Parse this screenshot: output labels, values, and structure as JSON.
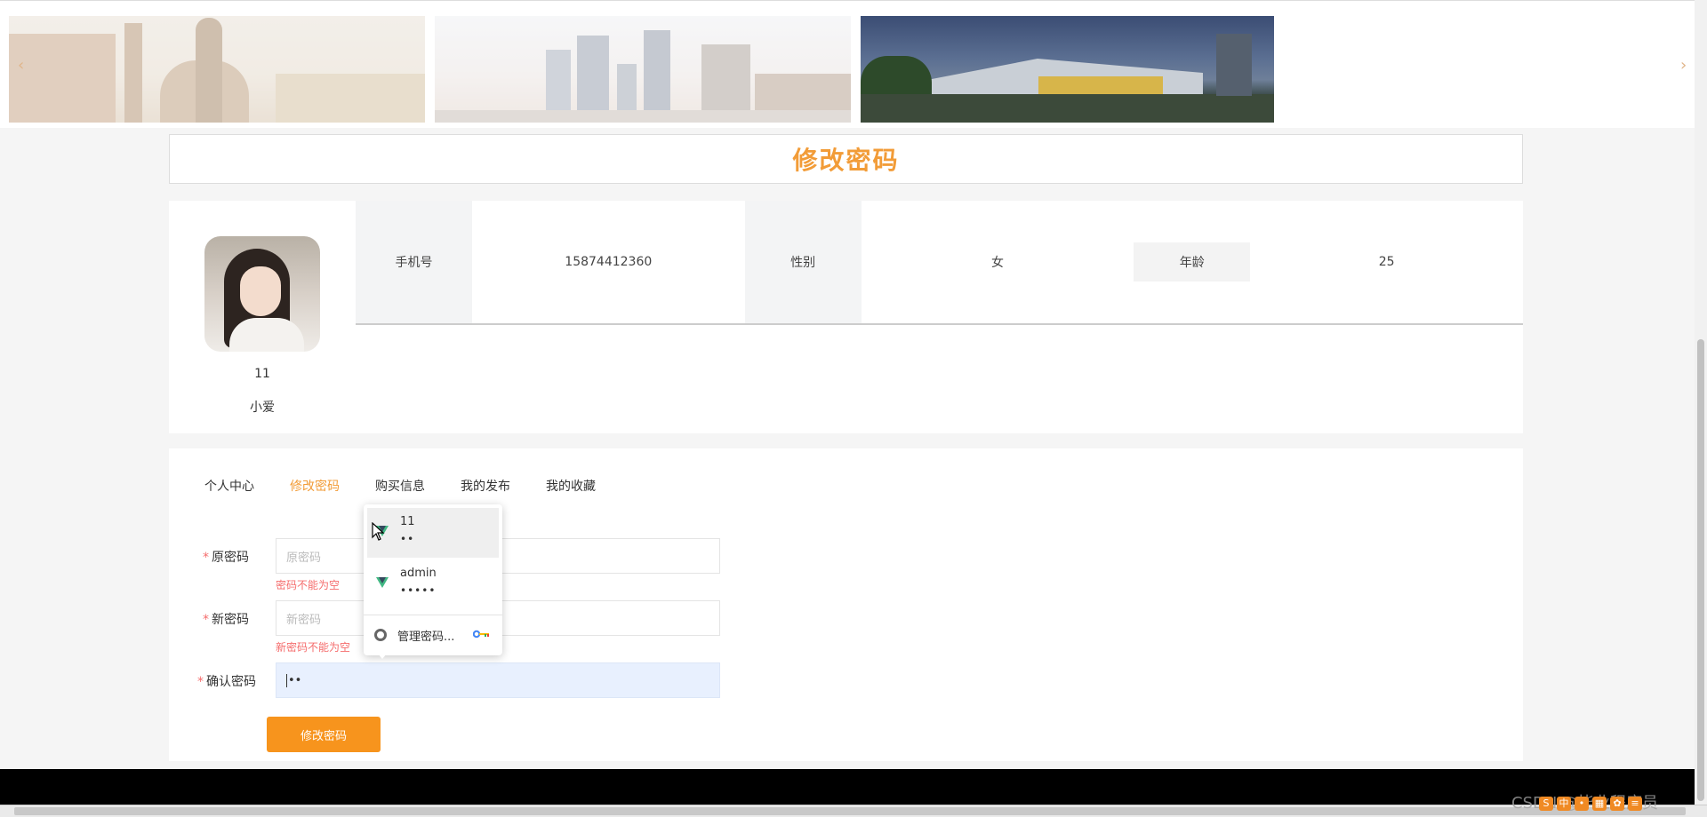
{
  "page_title": "修改密码",
  "profile": {
    "username": "11",
    "nickname": "小爱",
    "fields": [
      {
        "label": "手机号",
        "value": "15874412360"
      },
      {
        "label": "性别",
        "value": "女"
      },
      {
        "label": "年龄",
        "value": "25"
      }
    ]
  },
  "tabs": [
    "个人中心",
    "修改密码",
    "购买信息",
    "我的发布",
    "我的收藏"
  ],
  "active_tab": "修改密码",
  "form": {
    "old_password": {
      "label": "原密码",
      "placeholder": "原密码",
      "error": "密码不能为空"
    },
    "new_password": {
      "label": "新密码",
      "placeholder": "新密码",
      "error": "新密码不能为空"
    },
    "confirm_password": {
      "label": "确认密码",
      "value": "••"
    },
    "submit_label": "修改密码"
  },
  "autofill": {
    "entries": [
      {
        "user": "11",
        "password": "••"
      },
      {
        "user": "admin",
        "password": "•••••"
      }
    ],
    "manage_label": "管理密码..."
  },
  "watermark": "CSDN @毕业程序员",
  "colors": {
    "accent": "#f29c38",
    "button": "#f7941d",
    "error": "#f56c6c"
  }
}
